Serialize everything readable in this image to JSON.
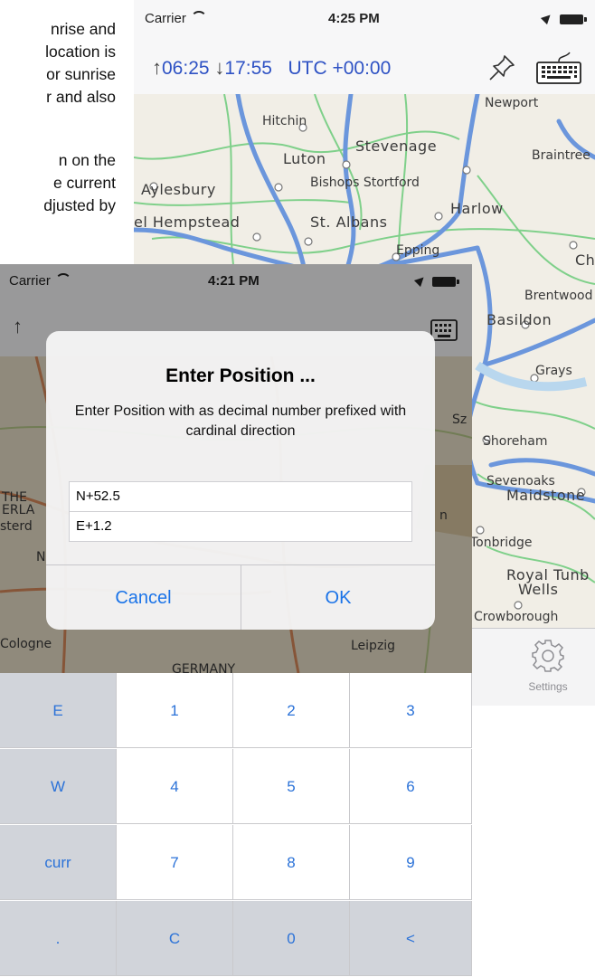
{
  "document_text": {
    "lines": [
      "nrise and",
      "location is",
      "or sunrise",
      "r and also"
    ],
    "lines2": [
      "n on the",
      "e current",
      "djusted by"
    ]
  },
  "back_screen": {
    "status": {
      "carrier": "Carrier",
      "time": "4:25 PM"
    },
    "toolbar": {
      "sunrise_symbol": "↑",
      "sunrise": "06:25",
      "sunset_symbol": "↓",
      "sunset": "17:55",
      "utc_offset": "UTC +00:00",
      "pin_icon": "pin-icon",
      "keyboard_icon": "keyboard-icon"
    },
    "map_places": [
      "Newport",
      "Hitchin",
      "Stevenage",
      "Luton",
      "Braintree",
      "Aylesbury",
      "Bishops Stortford",
      "Harlow",
      "el Hempstead",
      "St. Albans",
      "Epping",
      "Ch",
      "Brentwood",
      "Basildon",
      "Grays",
      "Shoreham",
      "Sevenoaks",
      "Maidstone",
      "Tonbridge",
      "Royal Tunb",
      "Wells",
      "Crowborough"
    ],
    "tabbar": {
      "settings_label": "Settings",
      "settings_icon": "gear-icon"
    }
  },
  "front_screen": {
    "status": {
      "carrier": "Carrier",
      "time": "4:21 PM"
    },
    "map_places": [
      "THE",
      "ERLA",
      "sterd",
      "N",
      "Cologne",
      "Leipzig",
      "GERMANY",
      "Sz",
      "n"
    ],
    "dialog": {
      "title": "Enter Position ...",
      "message": "Enter Position with as decimal number prefixed with cardinal direction",
      "latitude_value": "N+52.5",
      "longitude_value": "E+1.2",
      "cancel_label": "Cancel",
      "ok_label": "OK"
    },
    "keypad": {
      "rows": [
        [
          "E",
          "1",
          "2",
          "3"
        ],
        [
          "W",
          "4",
          "5",
          "6"
        ],
        [
          "curr",
          "7",
          "8",
          "9"
        ],
        [
          ".",
          "C",
          "0",
          "<"
        ]
      ]
    }
  },
  "colors": {
    "accent_blue": "#1a73e8",
    "toolbar_text_blue": "#2e52c4",
    "road_blue": "#6b96dc",
    "road_green": "#7fd08a"
  }
}
